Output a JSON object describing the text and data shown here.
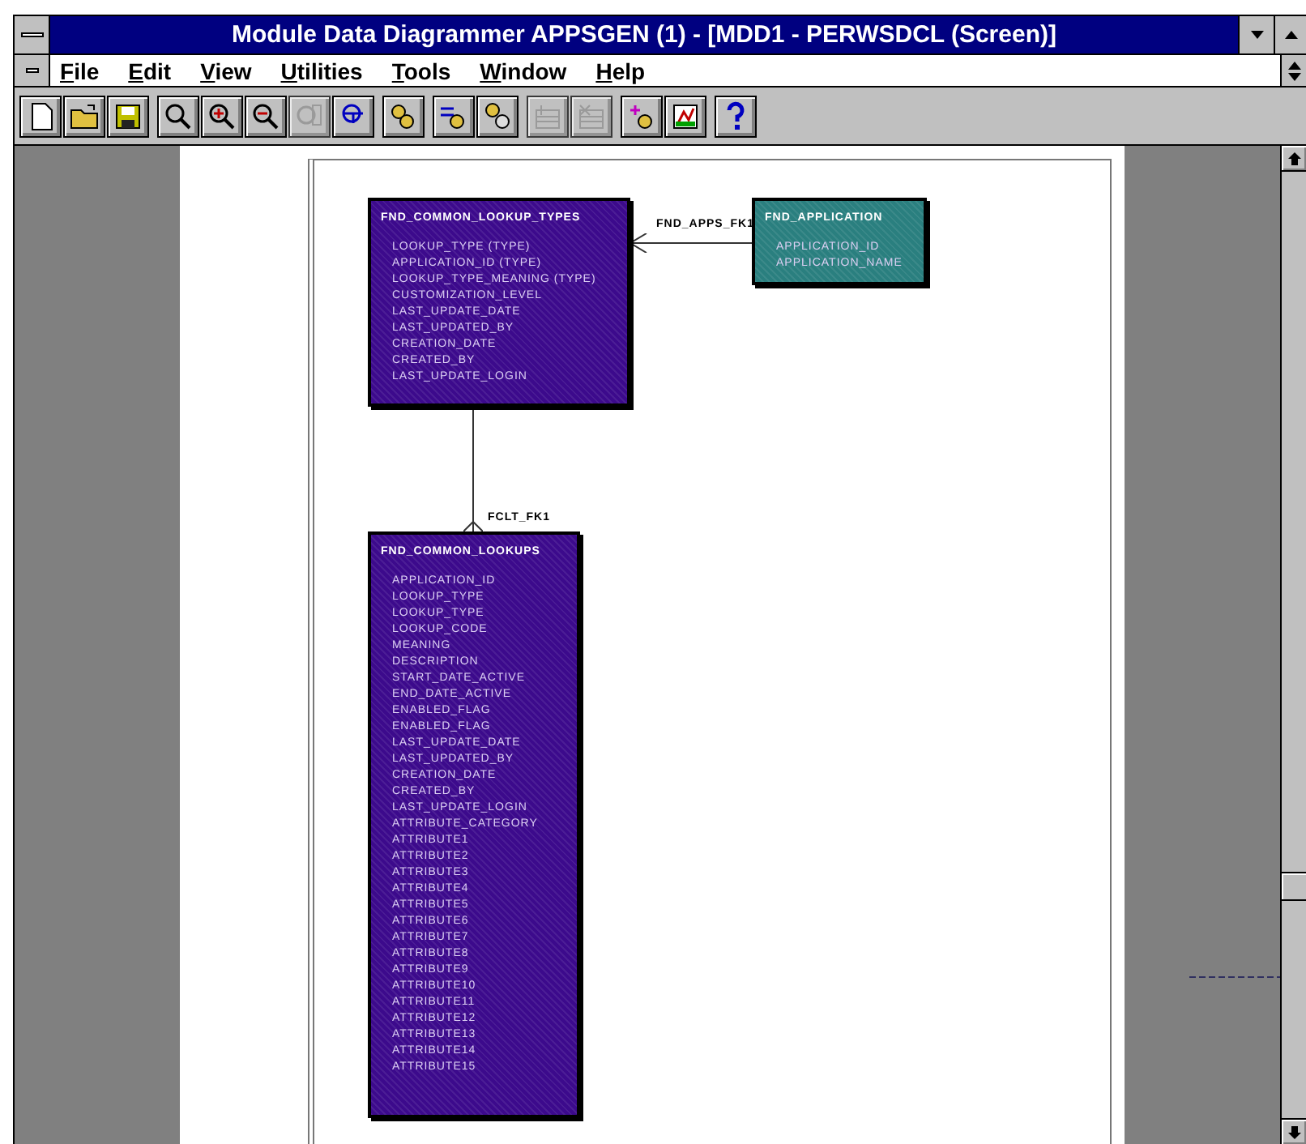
{
  "window": {
    "title": "Module Data Diagrammer APPSGEN (1) - [MDD1 - PERWSDCL (Screen)]"
  },
  "menu": [
    {
      "label": "File"
    },
    {
      "label": "Edit"
    },
    {
      "label": "View"
    },
    {
      "label": "Utilities"
    },
    {
      "label": "Tools"
    },
    {
      "label": "Window"
    },
    {
      "label": "Help"
    }
  ],
  "toolbar": [
    [
      {
        "kind": "new",
        "disabled": false
      },
      {
        "kind": "open",
        "disabled": false
      },
      {
        "kind": "save",
        "disabled": false
      }
    ],
    [
      {
        "kind": "zoom",
        "disabled": false
      },
      {
        "kind": "zoom-in",
        "disabled": false
      },
      {
        "kind": "zoom-out",
        "disabled": false
      },
      {
        "kind": "fit",
        "disabled": true
      },
      {
        "kind": "layout",
        "disabled": false
      }
    ],
    [
      {
        "kind": "gears",
        "disabled": false
      }
    ],
    [
      {
        "kind": "arrow-gear",
        "disabled": false
      },
      {
        "kind": "gear-db",
        "disabled": false
      }
    ],
    [
      {
        "kind": "add-row",
        "disabled": true
      },
      {
        "kind": "remove-row",
        "disabled": true
      }
    ],
    [
      {
        "kind": "gear-plus",
        "disabled": false
      },
      {
        "kind": "chart",
        "disabled": false
      }
    ],
    [
      {
        "kind": "help",
        "disabled": false
      }
    ]
  ],
  "diagram": {
    "tables": [
      {
        "name": "FND_COMMON_LOOKUP_TYPES",
        "color": "#3c0a8c",
        "columns": [
          "LOOKUP_TYPE (TYPE)",
          "APPLICATION_ID (TYPE)",
          "LOOKUP_TYPE_MEANING (TYPE)",
          "CUSTOMIZATION_LEVEL",
          "LAST_UPDATE_DATE",
          "LAST_UPDATED_BY",
          "CREATION_DATE",
          "CREATED_BY",
          "LAST_UPDATE_LOGIN"
        ]
      },
      {
        "name": "FND_APPLICATION",
        "color": "#2a7f7f",
        "columns": [
          "APPLICATION_ID",
          "APPLICATION_NAME"
        ]
      },
      {
        "name": "FND_COMMON_LOOKUPS",
        "color": "#3c0a8c",
        "columns": [
          "APPLICATION_ID",
          "LOOKUP_TYPE",
          "LOOKUP_TYPE",
          "LOOKUP_CODE",
          "MEANING",
          "DESCRIPTION",
          "START_DATE_ACTIVE",
          "END_DATE_ACTIVE",
          "ENABLED_FLAG",
          "ENABLED_FLAG",
          "LAST_UPDATE_DATE",
          "LAST_UPDATED_BY",
          "CREATION_DATE",
          "CREATED_BY",
          "LAST_UPDATE_LOGIN",
          "ATTRIBUTE_CATEGORY",
          "ATTRIBUTE1",
          "ATTRIBUTE2",
          "ATTRIBUTE3",
          "ATTRIBUTE4",
          "ATTRIBUTE5",
          "ATTRIBUTE6",
          "ATTRIBUTE7",
          "ATTRIBUTE8",
          "ATTRIBUTE9",
          "ATTRIBUTE10",
          "ATTRIBUTE11",
          "ATTRIBUTE12",
          "ATTRIBUTE13",
          "ATTRIBUTE14",
          "ATTRIBUTE15"
        ]
      }
    ],
    "relationships": [
      {
        "label": "FND_APPS_FK1"
      },
      {
        "label": "FCLT_FK1"
      }
    ]
  }
}
